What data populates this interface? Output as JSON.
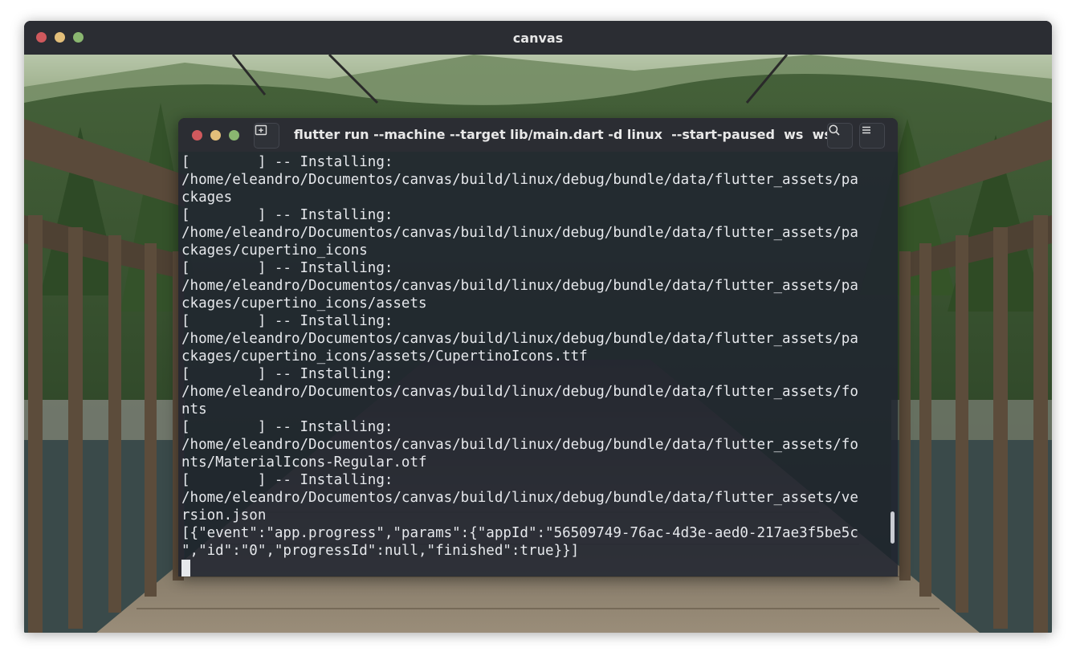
{
  "app_window": {
    "title": "canvas"
  },
  "terminal": {
    "title": "flutter run --machine --target lib/main.dart -d linux  --start-paused  ws  ws",
    "new_tab_icon": "new-tab-icon",
    "search_icon": "search-icon",
    "menu_icon": "hamburger-menu-icon",
    "lines": [
      "[        ] -- Installing:",
      "/home/eleandro/Documentos/canvas/build/linux/debug/bundle/data/flutter_assets/pa",
      "ckages",
      "[        ] -- Installing:",
      "/home/eleandro/Documentos/canvas/build/linux/debug/bundle/data/flutter_assets/pa",
      "ckages/cupertino_icons",
      "[        ] -- Installing:",
      "/home/eleandro/Documentos/canvas/build/linux/debug/bundle/data/flutter_assets/pa",
      "ckages/cupertino_icons/assets",
      "[        ] -- Installing:",
      "/home/eleandro/Documentos/canvas/build/linux/debug/bundle/data/flutter_assets/pa",
      "ckages/cupertino_icons/assets/CupertinoIcons.ttf",
      "[        ] -- Installing:",
      "/home/eleandro/Documentos/canvas/build/linux/debug/bundle/data/flutter_assets/fo",
      "nts",
      "[        ] -- Installing:",
      "/home/eleandro/Documentos/canvas/build/linux/debug/bundle/data/flutter_assets/fo",
      "nts/MaterialIcons-Regular.otf",
      "[        ] -- Installing:",
      "/home/eleandro/Documentos/canvas/build/linux/debug/bundle/data/flutter_assets/ve",
      "rsion.json",
      "[{\"event\":\"app.progress\",\"params\":{\"appId\":\"56509749-76ac-4d3e-aed0-217ae3f5be5c",
      "\",\"id\":\"0\",\"progressId\":null,\"finished\":true}}]"
    ]
  },
  "colors": {
    "close": "#d0595d",
    "minimize": "#e3bf7a",
    "maximize": "#8ab670",
    "titlebar": "#2b2d33",
    "terminal_text": "#e6e8ec"
  }
}
